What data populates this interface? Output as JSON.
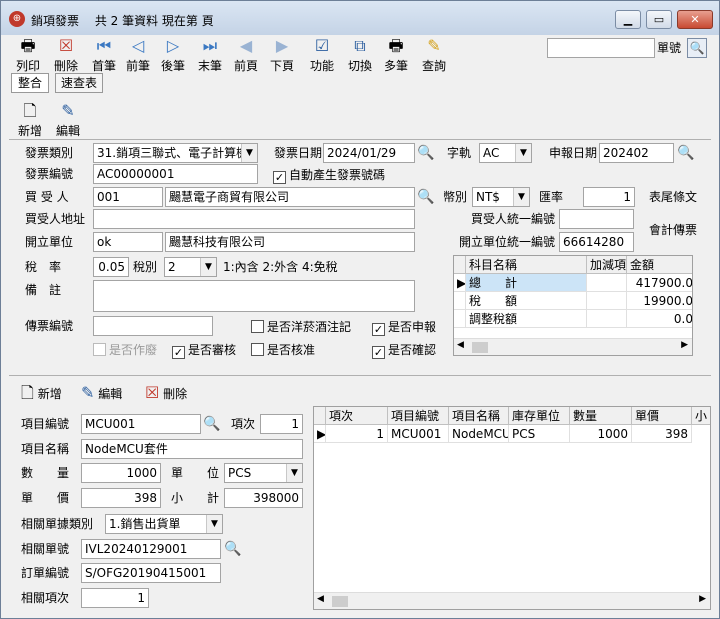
{
  "window": {
    "title": "銷項發票",
    "record_info": "共 2 筆資料  現在第 頁",
    "title_icon": "⊕"
  },
  "toolbar": {
    "print": "列印",
    "delete": "刪除",
    "first": "首筆",
    "prev": "前筆",
    "next": "後筆",
    "last": "末筆",
    "prev_page": "前頁",
    "next_page": "下頁",
    "function": "功能",
    "switch": "切換",
    "multi": "多筆",
    "query": "查詢",
    "doc_no_label": "單號",
    "doc_no_value": ""
  },
  "tabs": {
    "integrate": "整合",
    "quick": "速查表"
  },
  "actions": {
    "add": "新增",
    "edit": "編輯"
  },
  "header": {
    "invoice_type_label": "發票類別",
    "invoice_type_value": "31.銷項三聯式、電子計算機",
    "invoice_date_label": "發票日期",
    "invoice_date_value": "2024/01/29",
    "word_label": "字軌",
    "word_value": "AC",
    "report_date_label": "申報日期",
    "report_date_value": "202402",
    "invoice_no_label": "發票編號",
    "invoice_no_value": "AC00000001",
    "auto_no_label": "自動產生發票號碼",
    "buyer_label": "買 受 人",
    "buyer_code": "001",
    "buyer_name": "颺慧電子商貿有限公司",
    "currency_label": "幣別",
    "currency_value": "NT$",
    "rate_label": "匯率",
    "rate_value": "1",
    "tail_label": "表尾條文",
    "buyer_addr_label": "買受人地址",
    "buyer_addr_value": "",
    "buyer_taxid_label": "買受人統一編號",
    "buyer_taxid_value": "",
    "issuer_label": "開立單位",
    "issuer_code": "ok",
    "issuer_name": "颺慧科技有限公司",
    "issuer_taxid_label": "開立單位統一編號",
    "issuer_taxid_value": "66614280",
    "accounting_label": "會計傳票",
    "tax_rate_label": "稅　率",
    "tax_rate_value": "0.05",
    "tax_type_label": "稅別",
    "tax_type_value": "2",
    "tax_type_hint": "1:內含 2:外含 4:免稅",
    "remark_label": "備　註",
    "remark_value": "",
    "voucher_label": "傳票編號",
    "voucher_value": "",
    "tobacco_label": "是否洋菸酒注記",
    "declared_label": "是否申報",
    "void_label": "是否作廢",
    "reviewed_label": "是否審核",
    "approved_label": "是否核准",
    "confirmed_label": "是否確認"
  },
  "summary_grid": {
    "columns": [
      "科目名稱",
      "加減項",
      "金額"
    ],
    "rows": [
      {
        "name": "總　　計",
        "adj": "",
        "amount": "417900.0"
      },
      {
        "name": "稅　　額",
        "adj": "",
        "amount": "19900.0"
      },
      {
        "name": "調整稅額",
        "adj": "",
        "amount": "0.0"
      }
    ]
  },
  "detail_actions": {
    "add": "新增",
    "edit": "編輯",
    "delete": "刪除"
  },
  "detail": {
    "item_code_label": "項目編號",
    "item_code_value": "MCU001",
    "seq_label": "項次",
    "seq_value": "1",
    "item_name_label": "項目名稱",
    "item_name_value": "NodeMCU套件",
    "qty_label": "數　　量",
    "qty_value": "1000",
    "unit_label": "單　　位",
    "unit_value": "PCS",
    "price_label": "單　　價",
    "price_value": "398",
    "subtotal_label": "小　　計",
    "subtotal_value": "398000",
    "ref_type_label": "相關單據類別",
    "ref_type_value": "1.銷售出貨單",
    "ref_no_label": "相關單號",
    "ref_no_value": "IVL20240129001",
    "order_no_label": "訂單編號",
    "order_no_value": "S/OFG20190415001",
    "ref_seq_label": "相關項次",
    "ref_seq_value": "1"
  },
  "detail_grid": {
    "columns": [
      "項次",
      "項目編號",
      "項目名稱",
      "庫存單位",
      "數量",
      "單價",
      "小"
    ],
    "rows": [
      {
        "seq": "1",
        "code": "MCU001",
        "name": "NodeMCU套",
        "unit": "PCS",
        "qty": "1000",
        "price": "398"
      }
    ]
  }
}
